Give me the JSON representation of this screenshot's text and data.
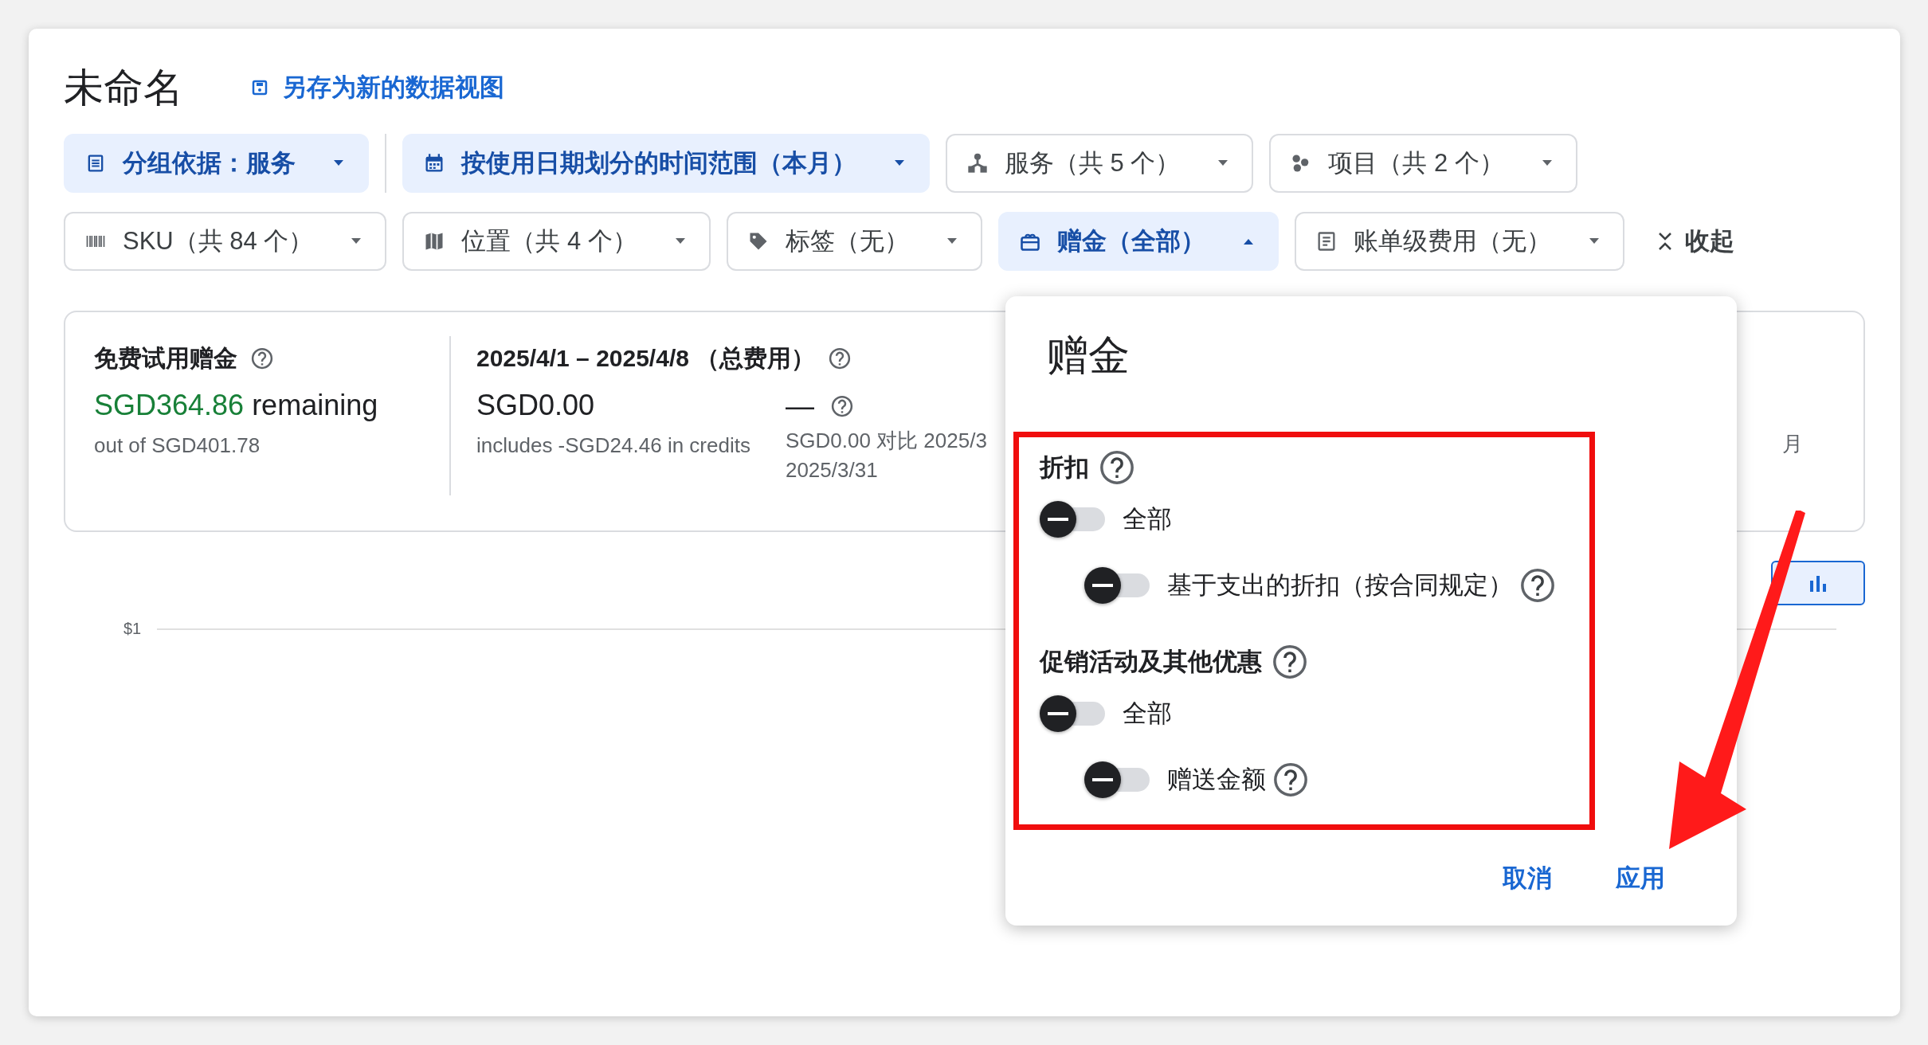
{
  "title": "未命名",
  "save_link": "另存为新的数据视图",
  "filter_rows": [
    [
      {
        "label": "分组依据：服务",
        "active": true,
        "expanded": false
      },
      {
        "label": "按使用日期划分的时间范围（本月）",
        "active": true,
        "expanded": false
      },
      {
        "label": "服务（共 5 个）",
        "active": false,
        "expanded": false
      },
      {
        "label": "项目（共 2 个）",
        "active": false,
        "expanded": false
      }
    ],
    [
      {
        "label": "SKU（共 84 个）",
        "active": false,
        "expanded": false
      },
      {
        "label": "位置（共 4 个）",
        "active": false,
        "expanded": false
      },
      {
        "label": "标签（无）",
        "active": false,
        "expanded": false
      },
      {
        "label": "赠金（全部）",
        "active": true,
        "expanded": true
      },
      {
        "label": "账单级费用（无）",
        "active": false,
        "expanded": false
      }
    ]
  ],
  "collapse_button": "收起",
  "summary": {
    "credits": {
      "title": "免费试用赠金",
      "amount": "SGD364.86",
      "amount_suffix": "remaining",
      "note": "out of SGD401.78"
    },
    "total": {
      "title": "2025/4/1 – 2025/4/8 （总费用）",
      "amount": "SGD0.00",
      "note": "includes -SGD24.46 in credits"
    },
    "change": {
      "value": "—",
      "note_lines": [
        "SGD0.00 对比 2025/3",
        "2025/3/31"
      ]
    },
    "right_fragment": "月"
  },
  "chart": {
    "y_tick": "$1"
  },
  "popup": {
    "title": "赠金",
    "groups": [
      {
        "heading": "折扣",
        "toggles": [
          {
            "label": "全部",
            "checked": false,
            "indeterminate": true,
            "help": false,
            "children": [
              {
                "label": "基于支出的折扣（按合同规定）",
                "checked": false,
                "indeterminate": true,
                "help": true
              }
            ]
          }
        ]
      },
      {
        "heading": "促销活动及其他优惠",
        "toggles": [
          {
            "label": "全部",
            "checked": false,
            "indeterminate": true,
            "help": false,
            "children": [
              {
                "label": "赠送金额",
                "checked": false,
                "indeterminate": true,
                "help": true
              }
            ]
          }
        ]
      }
    ],
    "cancel": "取消",
    "apply": "应用"
  }
}
